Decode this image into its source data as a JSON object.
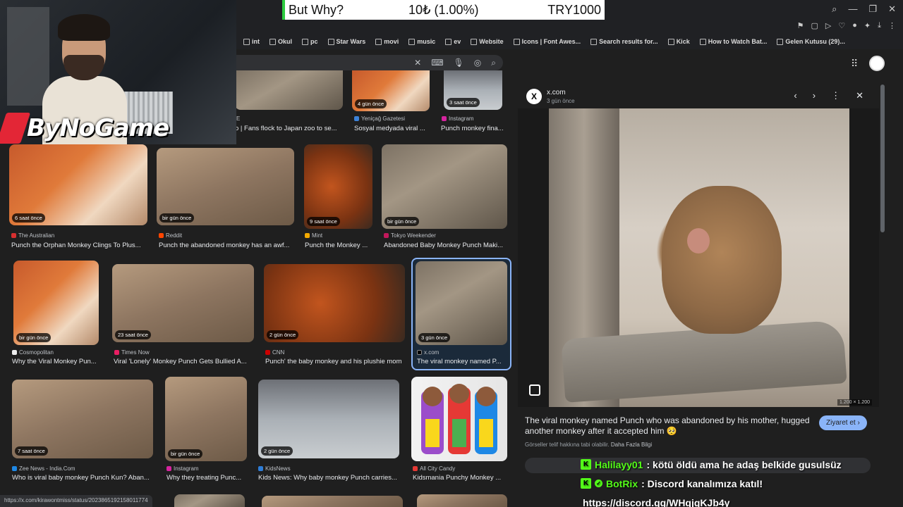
{
  "ticker": {
    "name": "But Why?",
    "change": "10₺ (1.00%)",
    "amount": "TRY1000"
  },
  "overlay": {
    "logo_text": "ByNoGame"
  },
  "bookmarks": [
    "int",
    "Okul",
    "pc",
    "Star Wars",
    "movi",
    "music",
    "ev",
    "Website",
    "Icons | Font Awes...",
    "Search results for...",
    "Kick",
    "How to Watch Bat...",
    "Gelen Kutusu (29)..."
  ],
  "results": [
    {
      "badge": "",
      "source": "E",
      "caption": "o | Fans flock to Japan zoo to se..."
    },
    {
      "badge": "4 gün önce",
      "source": "Yeniçağ Gazetesi",
      "caption": "Sosyal medyada viral ..."
    },
    {
      "badge": "3 saat önce",
      "source": "Instagram",
      "caption": "Punch monkey fina..."
    },
    {
      "badge": "6 saat önce",
      "source": "The Australian",
      "caption": "Punch the Orphan Monkey Clings To Plus..."
    },
    {
      "badge": "bir gün önce",
      "source": "Reddit",
      "caption": "Punch the abandoned monkey has an awf..."
    },
    {
      "badge": "9 saat önce",
      "source": "Mint",
      "caption": "Punch the Monkey ..."
    },
    {
      "badge": "bir gün önce",
      "source": "Tokyo Weekender",
      "caption": "Abandoned Baby Monkey Punch Maki..."
    },
    {
      "badge": "bir gün önce",
      "source": "Cosmopolitan",
      "caption": "Why the Viral Monkey Pun..."
    },
    {
      "badge": "23 saat önce",
      "source": "Times Now",
      "caption": "Viral 'Lonely' Monkey Punch Gets Bullied A..."
    },
    {
      "badge": "2 gün önce",
      "source": "CNN",
      "caption": "Punch' the baby monkey and his plushie mom"
    },
    {
      "badge": "3 gün önce",
      "source": "x.com",
      "caption": "The viral monkey named P..."
    },
    {
      "badge": "7 saat önce",
      "source": "Zee News - India.Com",
      "caption": "Who is viral baby monkey Punch Kun? Aban..."
    },
    {
      "badge": "bir gün önce",
      "source": "Instagram",
      "caption": "Why they treating Punc..."
    },
    {
      "badge": "2 gün önce",
      "source": "KidsNews",
      "caption": "Kids News: Why baby monkey Punch carries..."
    },
    {
      "badge": "",
      "source": "All City Candy",
      "caption": "Kidsmania Punchy Monkey ..."
    }
  ],
  "preview": {
    "site": "x.com",
    "time": "3 gün önce",
    "logo": "X",
    "dimensions": "1.200 × 1.200",
    "caption": "The viral monkey named Punch who was abandoned by his mother, hugged another monkey after it accepted him 🥺",
    "visit_label": "Ziyaret et ›",
    "license": "Görseller telif hakkına tabi olabilir.",
    "license_link": "Daha Fazla Bilgi"
  },
  "chat": [
    {
      "user": "Halilayy01",
      "message": ": kötü öldü ama he adaş belkide gusulsüz"
    },
    {
      "user": "BotRix",
      "message": ": Discord kanalımıza katıl!"
    },
    {
      "user": "",
      "message": "https://discord.gg/WHqjgKJb4y"
    }
  ],
  "status_url": "https://x.com/kirawontmiss/status/2023865192158011774"
}
